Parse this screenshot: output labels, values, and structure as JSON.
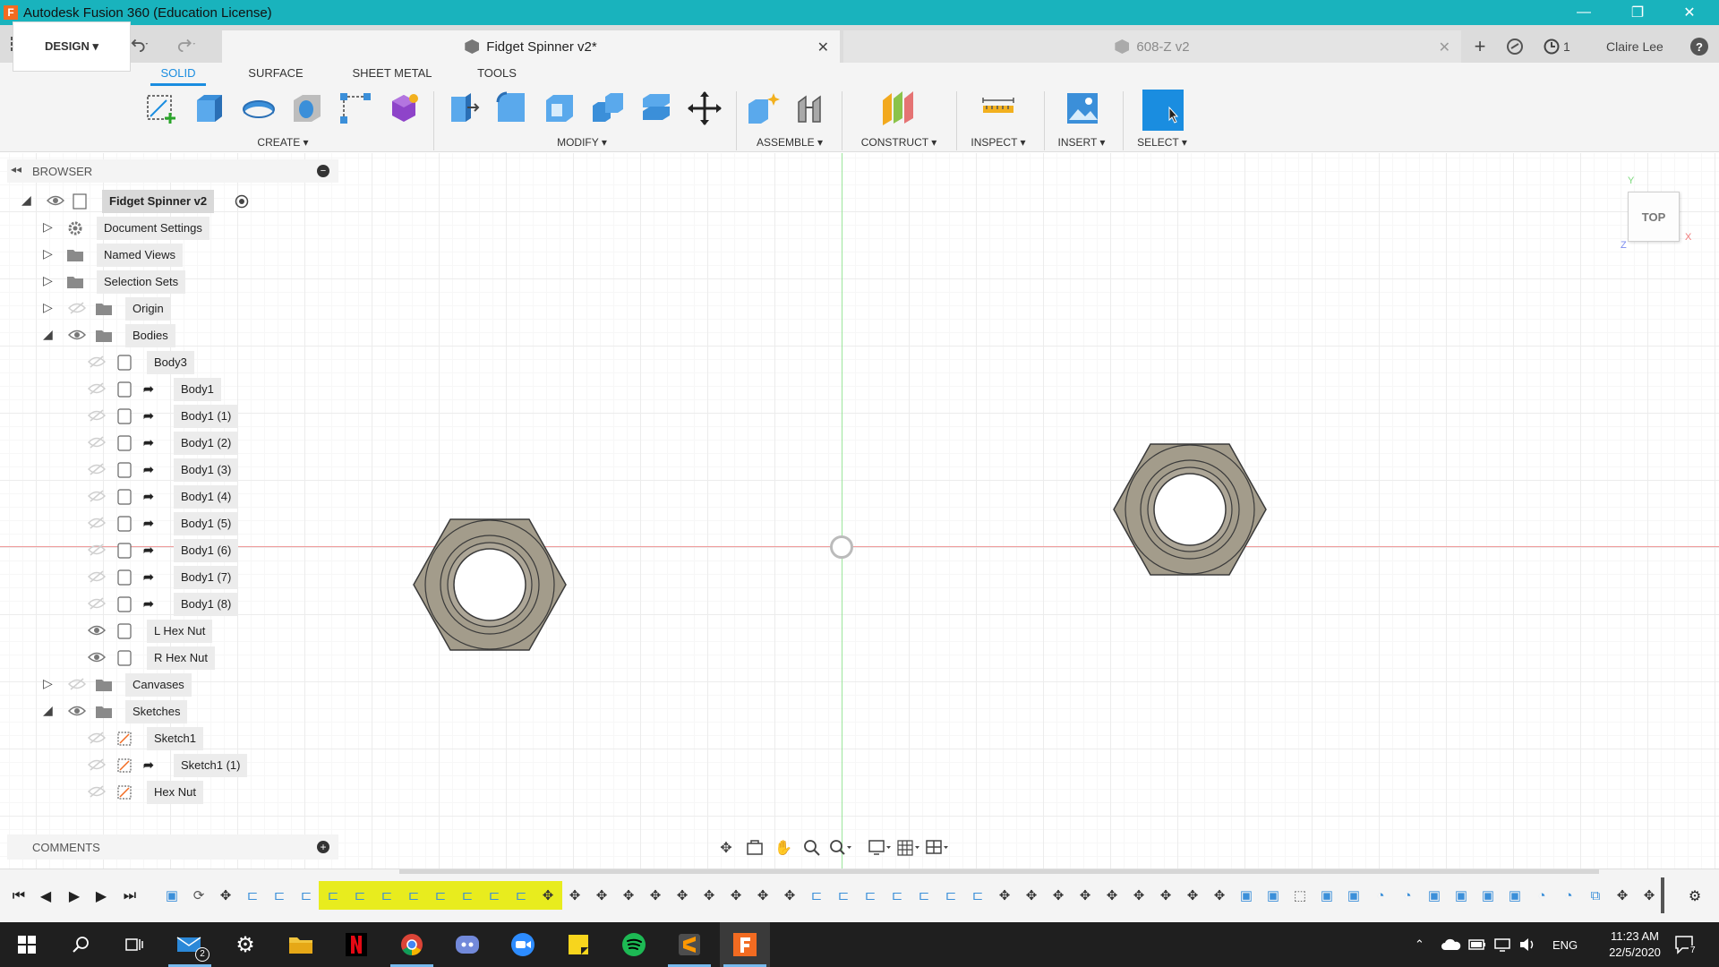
{
  "window": {
    "title": "Autodesk Fusion 360 (Education License)",
    "app_icon_letter": "F",
    "minimize": "—",
    "restore": "❐",
    "close": "✕"
  },
  "tabs": {
    "active": {
      "label": "Fidget  Spinner v2*",
      "close": "✕"
    },
    "inactive": {
      "label": "608-Z v2",
      "close": "✕"
    },
    "new_tab": "+",
    "jobs_count": "1",
    "user": "Claire Lee",
    "help": "?"
  },
  "toolbar": {
    "workspace": "DESIGN ▾",
    "workspace_tabs": [
      "SOLID",
      "SURFACE",
      "SHEET METAL",
      "TOOLS"
    ],
    "groups": {
      "create": "CREATE ▾",
      "modify": "MODIFY ▾",
      "assemble": "ASSEMBLE ▾",
      "construct": "CONSTRUCT ▾",
      "inspect": "INSPECT ▾",
      "insert": "INSERT ▾",
      "select": "SELECT ▾"
    }
  },
  "browser": {
    "title": "BROWSER",
    "root": "Fidget  Spinner v2",
    "items": [
      "Document Settings",
      "Named Views",
      "Selection Sets",
      "Origin",
      "Bodies",
      "Body3",
      "Body1",
      "Body1 (1)",
      "Body1 (2)",
      "Body1 (3)",
      "Body1 (4)",
      "Body1 (5)",
      "Body1 (6)",
      "Body1 (7)",
      "Body1 (8)",
      "L Hex Nut",
      "R Hex Nut",
      "Canvases",
      "Sketches",
      "Sketch1",
      "Sketch1 (1)",
      "Hex Nut"
    ]
  },
  "comments": {
    "title": "COMMENTS"
  },
  "viewcube": {
    "face": "TOP",
    "x": "X",
    "y": "Y",
    "z": "Z"
  },
  "colors": {
    "titlebar": "#19b3bd",
    "accent": "#1a8de0",
    "nut_fill": "#a39c8b",
    "timeline_highlight": "#e8ec1e",
    "x_axis": "#ef9a9a",
    "y_axis": "#9be59b"
  },
  "taskbar": {
    "mail_badge": "2",
    "language": "ENG",
    "time": "11:23 AM",
    "date": "22/5/2020",
    "notifications": "7",
    "apps": [
      "start-icon",
      "search-icon",
      "task-view-icon",
      "mail-icon",
      "settings-icon",
      "file-explorer-icon",
      "netflix-icon",
      "chrome-icon",
      "discord-icon",
      "zoom-icon",
      "sticky-notes-icon",
      "spotify-icon",
      "sublime-text-icon",
      "fusion-360-icon"
    ]
  }
}
